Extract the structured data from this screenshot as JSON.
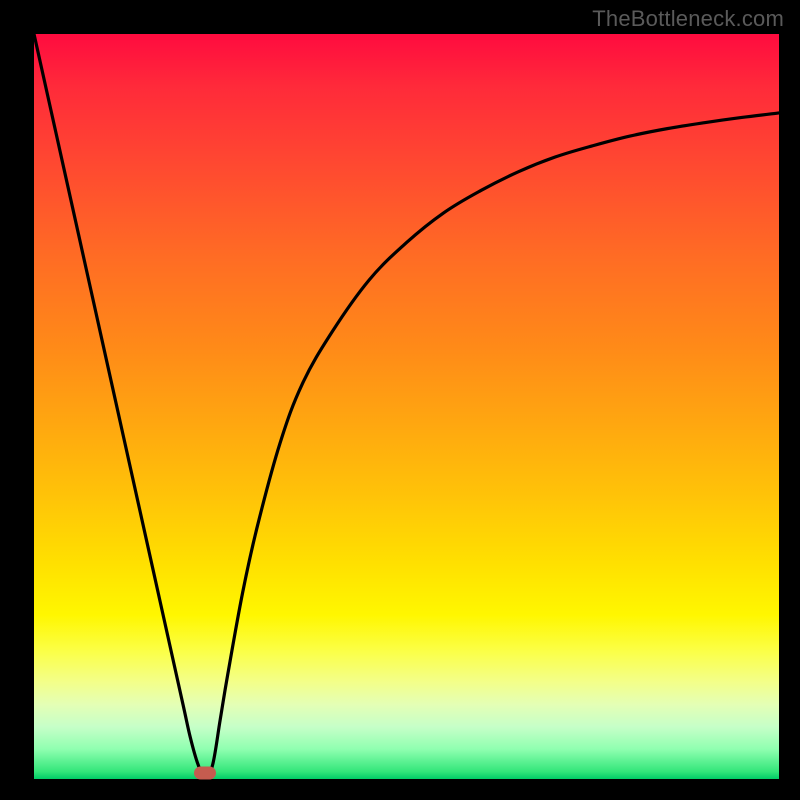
{
  "watermark": "TheBottleneck.com",
  "chart_data": {
    "type": "line",
    "title": "",
    "xlabel": "",
    "ylabel": "",
    "xlim": [
      0,
      100
    ],
    "ylim": [
      0,
      100
    ],
    "grid": false,
    "series": [
      {
        "name": "curve",
        "x": [
          0,
          2,
          4,
          6,
          8,
          10,
          12,
          14,
          16,
          18,
          20,
          21,
          22,
          23,
          24,
          25,
          26,
          28,
          30,
          33,
          36,
          40,
          45,
          50,
          55,
          60,
          65,
          70,
          75,
          80,
          85,
          90,
          95,
          100
        ],
        "y": [
          100,
          91,
          82,
          73,
          64,
          55,
          46,
          37,
          28,
          19,
          10,
          5.5,
          2,
          0,
          2,
          8,
          14,
          25,
          34,
          45,
          53,
          60,
          67,
          72,
          76,
          79,
          81.5,
          83.5,
          85,
          86.3,
          87.3,
          88.1,
          88.8,
          89.4
        ]
      }
    ],
    "marker": {
      "x": 23,
      "y": 0.8
    },
    "background_gradient": {
      "top": "#ff0b3f",
      "bottom": "#00cc66"
    }
  }
}
